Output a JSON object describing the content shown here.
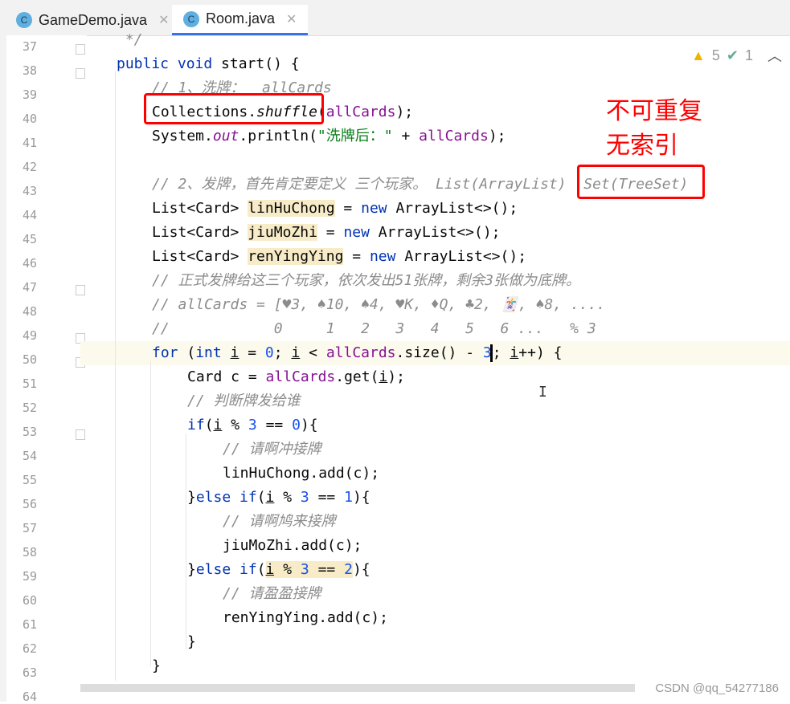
{
  "tabs": [
    {
      "label": "GameDemo.java",
      "icon": "java-class-run-icon",
      "active": false
    },
    {
      "label": "Room.java",
      "icon": "java-class-icon",
      "active": true
    }
  ],
  "inspections": {
    "warnings": "5",
    "typos": "1"
  },
  "annotations": {
    "note1": "不可重复",
    "note2": "无索引"
  },
  "watermark": "CSDN @qq_54277186",
  "colors": {
    "keyword": "#0033b3",
    "field": "#871094",
    "comment": "#8c8c8c",
    "number": "#1750eb",
    "string": "#067d17",
    "annotation": "#ff0000"
  },
  "lines": [
    {
      "n": "37",
      "ind": 1,
      "t": [
        [
          "c",
          " */"
        ]
      ]
    },
    {
      "n": "38",
      "ind": 1,
      "t": [
        [
          "k",
          "public void "
        ],
        [
          "",
          "start() {"
        ]
      ]
    },
    {
      "n": "39",
      "ind": 2,
      "t": [
        [
          "c",
          "// 1、洗牌：  allCards"
        ]
      ]
    },
    {
      "n": "40",
      "ind": 2,
      "t": [
        [
          "",
          "Collections."
        ],
        [
          "i",
          "shuffle"
        ],
        [
          "",
          "("
        ],
        [
          "f",
          "allCards"
        ],
        [
          "",
          ");"
        ]
      ]
    },
    {
      "n": "41",
      "ind": 2,
      "t": [
        [
          "",
          "System."
        ],
        [
          "o",
          "out"
        ],
        [
          "",
          ".println("
        ],
        [
          "s",
          "\"洗牌后：\""
        ],
        [
          "",
          " + "
        ],
        [
          "f",
          "allCards"
        ],
        [
          "",
          ");"
        ]
      ]
    },
    {
      "n": "42",
      "ind": 2,
      "t": []
    },
    {
      "n": "43",
      "ind": 2,
      "t": [
        [
          "c",
          "// 2、发牌，首先肯定要定义 三个玩家。 List(ArrayList)  Set(TreeSet)"
        ]
      ]
    },
    {
      "n": "44",
      "ind": 2,
      "t": [
        [
          "",
          "List<Card> "
        ],
        [
          "h",
          "linHuChong"
        ],
        [
          "",
          " = "
        ],
        [
          "k",
          "new "
        ],
        [
          "",
          "ArrayList<>();"
        ]
      ]
    },
    {
      "n": "45",
      "ind": 2,
      "t": [
        [
          "",
          "List<Card> "
        ],
        [
          "h",
          "jiuMoZhi"
        ],
        [
          "",
          " = "
        ],
        [
          "k",
          "new "
        ],
        [
          "",
          "ArrayList<>();"
        ]
      ]
    },
    {
      "n": "46",
      "ind": 2,
      "t": [
        [
          "",
          "List<Card> "
        ],
        [
          "h",
          "renYingYing"
        ],
        [
          "",
          " = "
        ],
        [
          "k",
          "new "
        ],
        [
          "",
          "ArrayList<>();"
        ]
      ]
    },
    {
      "n": "47",
      "ind": 2,
      "t": [
        [
          "c",
          "// 正式发牌给这三个玩家，依次发出51张牌，剩余3张做为底牌。"
        ]
      ]
    },
    {
      "n": "48",
      "ind": 2,
      "t": [
        [
          "c",
          "// allCards = [♥3, ♠10, ♠4, ♥K, ♦Q, ♣2, 🃏, ♠8, ...."
        ]
      ]
    },
    {
      "n": "49",
      "ind": 2,
      "t": [
        [
          "c",
          "//            0     1   2   3   4   5   6 ...   % 3"
        ]
      ]
    },
    {
      "n": "50",
      "ind": 2,
      "cur": true,
      "t": [
        [
          "k",
          "for "
        ],
        [
          "",
          "("
        ],
        [
          "k",
          "int "
        ],
        [
          "u",
          "i"
        ],
        [
          "",
          " = "
        ],
        [
          "n",
          "0"
        ],
        [
          "",
          "; "
        ],
        [
          "u",
          "i"
        ],
        [
          "",
          " < "
        ],
        [
          "f",
          "allCards"
        ],
        [
          "",
          ".size() - "
        ],
        [
          "n",
          "3"
        ],
        [
          "caret",
          ""
        ],
        [
          "",
          "; "
        ],
        [
          "u",
          "i"
        ],
        [
          "",
          "++) {"
        ]
      ]
    },
    {
      "n": "51",
      "ind": 3,
      "t": [
        [
          "",
          "Card c = "
        ],
        [
          "f",
          "allCards"
        ],
        [
          "",
          ".get("
        ],
        [
          "u",
          "i"
        ],
        [
          "",
          ");"
        ]
      ]
    },
    {
      "n": "52",
      "ind": 3,
      "t": [
        [
          "c",
          "// 判断牌发给谁"
        ]
      ]
    },
    {
      "n": "53",
      "ind": 3,
      "t": [
        [
          "k",
          "if"
        ],
        [
          "",
          "("
        ],
        [
          "u",
          "i"
        ],
        [
          "",
          " % "
        ],
        [
          "n",
          "3"
        ],
        [
          "",
          " == "
        ],
        [
          "n",
          "0"
        ],
        [
          "",
          "){"
        ]
      ]
    },
    {
      "n": "54",
      "ind": 4,
      "t": [
        [
          "c",
          "// 请啊冲接牌"
        ]
      ]
    },
    {
      "n": "55",
      "ind": 4,
      "t": [
        [
          "",
          "linHuChong.add(c);"
        ]
      ]
    },
    {
      "n": "56",
      "ind": 3,
      "t": [
        [
          "",
          "}"
        ],
        [
          "k",
          "else if"
        ],
        [
          "",
          "("
        ],
        [
          "u",
          "i"
        ],
        [
          "",
          " % "
        ],
        [
          "n",
          "3"
        ],
        [
          "",
          " == "
        ],
        [
          "n",
          "1"
        ],
        [
          "",
          "){"
        ]
      ]
    },
    {
      "n": "57",
      "ind": 4,
      "t": [
        [
          "c",
          "// 请啊鸠来接牌"
        ]
      ]
    },
    {
      "n": "58",
      "ind": 4,
      "t": [
        [
          "",
          "jiuMoZhi.add(c);"
        ]
      ]
    },
    {
      "n": "59",
      "ind": 3,
      "t": [
        [
          "",
          "}"
        ],
        [
          "k",
          "else if"
        ],
        [
          "",
          "("
        ],
        [
          "u h",
          "i"
        ],
        [
          "h",
          " % "
        ],
        [
          "n h",
          "3"
        ],
        [
          "h",
          " == "
        ],
        [
          "n h",
          "2"
        ],
        [
          "",
          "){"
        ]
      ]
    },
    {
      "n": "60",
      "ind": 4,
      "t": [
        [
          "c",
          "// 请盈盈接牌"
        ]
      ]
    },
    {
      "n": "61",
      "ind": 4,
      "t": [
        [
          "",
          "renYingYing.add(c);"
        ]
      ]
    },
    {
      "n": "62",
      "ind": 3,
      "t": [
        [
          "",
          "}"
        ]
      ]
    },
    {
      "n": "63",
      "ind": 2,
      "t": [
        [
          "",
          "}"
        ]
      ]
    },
    {
      "n": "64",
      "ind": 2,
      "t": []
    }
  ]
}
